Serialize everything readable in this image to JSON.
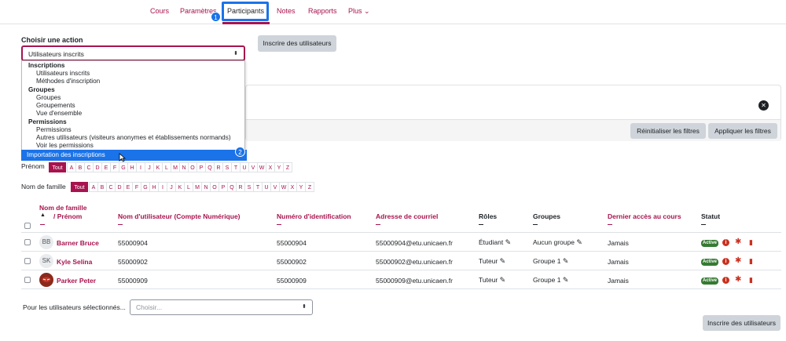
{
  "nav": {
    "tabs": [
      {
        "label": "Cours"
      },
      {
        "label": "Paramètres"
      },
      {
        "label": "Participants"
      },
      {
        "label": "Notes"
      },
      {
        "label": "Rapports"
      },
      {
        "label": "Plus"
      }
    ],
    "step1": "1",
    "more_caret": "⌄"
  },
  "action": {
    "label": "Choisir une action",
    "selected": "Utilisateurs inscrits",
    "enrol_button": "Inscrire des utilisateurs",
    "caret": "⬍"
  },
  "dropdown": {
    "groups": [
      {
        "title": "Inscriptions",
        "items": [
          "Utilisateurs inscrits",
          "Méthodes d'inscription"
        ]
      },
      {
        "title": "Groupes",
        "items": [
          "Groupes",
          "Groupements",
          "Vue d'ensemble"
        ]
      },
      {
        "title": "Permissions",
        "items": [
          "Permissions",
          "Autres utilisateurs (visiteurs anonymes et établissements normands)",
          "Voir les permissions"
        ]
      }
    ],
    "highlighted": "Importation des inscriptions",
    "step2": "2"
  },
  "filters": {
    "reset": "Réinitialiser les filtres",
    "apply": "Appliquer les filtres",
    "clear_icon": "✕"
  },
  "initials": {
    "firstname_label": "Prénom",
    "lastname_label": "Nom de famille",
    "all": "Tout",
    "letters": [
      "A",
      "B",
      "C",
      "D",
      "E",
      "F",
      "G",
      "H",
      "I",
      "J",
      "K",
      "L",
      "M",
      "N",
      "O",
      "P",
      "Q",
      "R",
      "S",
      "T",
      "U",
      "V",
      "W",
      "X",
      "Y",
      "Z"
    ]
  },
  "table": {
    "headers": {
      "name_line1": "Nom de famille",
      "name_line2": "/ Prénom",
      "sort_arrow": "▲",
      "username": "Nom d'utilisateur (Compte Numérique)",
      "idnumber": "Numéro d'identification",
      "email": "Adresse de courriel",
      "roles": "Rôles",
      "groups": "Groupes",
      "lastaccess": "Dernier accès au cours",
      "status": "Statut"
    },
    "rows": [
      {
        "initials": "BB",
        "name": "Barner Bruce",
        "username": "55000904",
        "idnumber": "55000904",
        "email": "55000904@etu.unicaen.fr",
        "role": "Étudiant",
        "group": "Aucun groupe",
        "lastaccess": "Jamais",
        "status": "Active"
      },
      {
        "initials": "SK",
        "name": "Kyle Selina",
        "username": "55000902",
        "idnumber": "55000902",
        "email": "55000902@etu.unicaen.fr",
        "role": "Tuteur",
        "group": "Groupe 1",
        "lastaccess": "Jamais",
        "status": "Active"
      },
      {
        "initials": "",
        "name": "Parker Peter",
        "username": "55000909",
        "idnumber": "55000909",
        "email": "55000909@etu.unicaen.fr",
        "role": "Tuteur",
        "group": "Groupe 1",
        "lastaccess": "Jamais",
        "status": "Active"
      }
    ]
  },
  "bulk": {
    "label": "Pour les utilisateurs sélectionnés...",
    "placeholder": "Choisir...",
    "enrol_button": "Inscrire des utilisateurs"
  },
  "icons": {
    "pencil": "✎",
    "info": "i",
    "gear": "✱",
    "trash": "▮"
  },
  "colors": {
    "accent": "#a7134e",
    "highlight": "#1a73e8",
    "success": "#357a32",
    "danger": "#ca3120"
  }
}
